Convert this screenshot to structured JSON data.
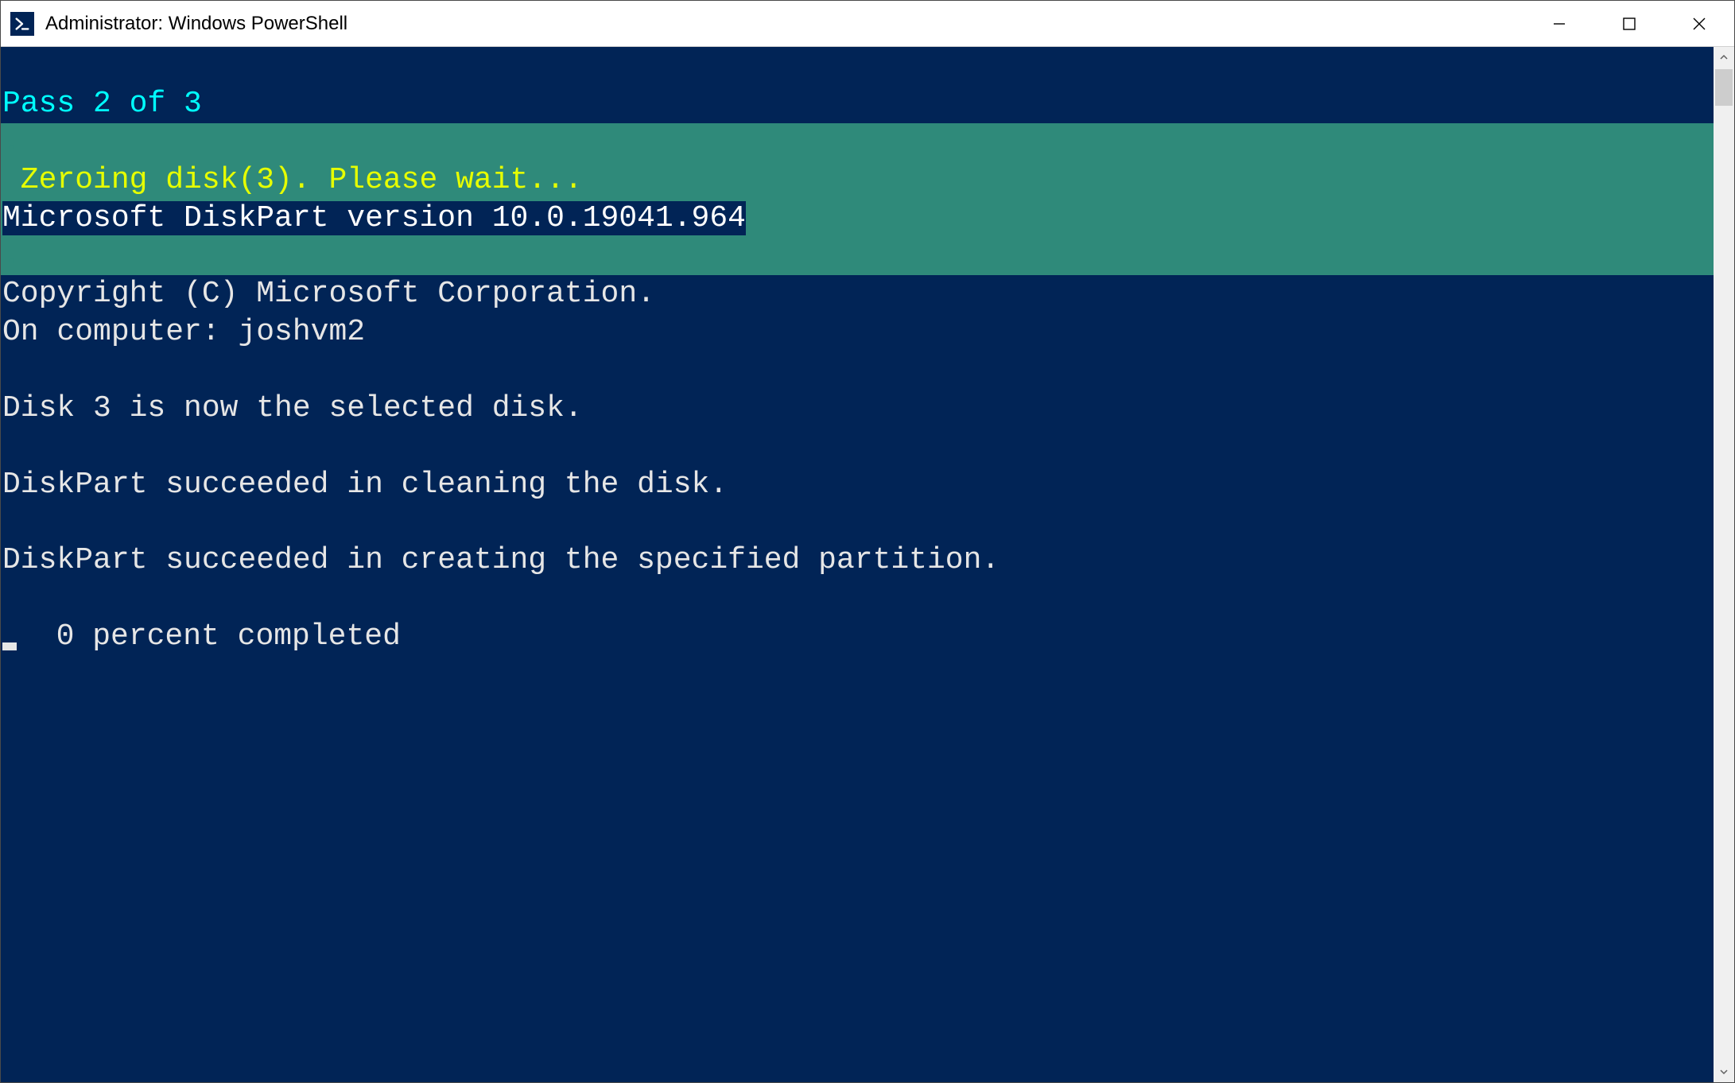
{
  "window": {
    "title": "Administrator: Windows PowerShell"
  },
  "terminal": {
    "pass_line": "Pass 2 of 3",
    "zero_line": " Zeroing disk(3). Please wait...",
    "diskpart_version": "Microsoft DiskPart version 10.0.19041.964",
    "copyright": "Copyright (C) Microsoft Corporation.",
    "computer": "On computer: joshvm2",
    "selected": "Disk 3 is now the selected disk.",
    "cleaned": "DiskPart succeeded in cleaning the disk.",
    "partition": "DiskPart succeeded in creating the specified partition.",
    "percent": "  0 percent completed"
  }
}
